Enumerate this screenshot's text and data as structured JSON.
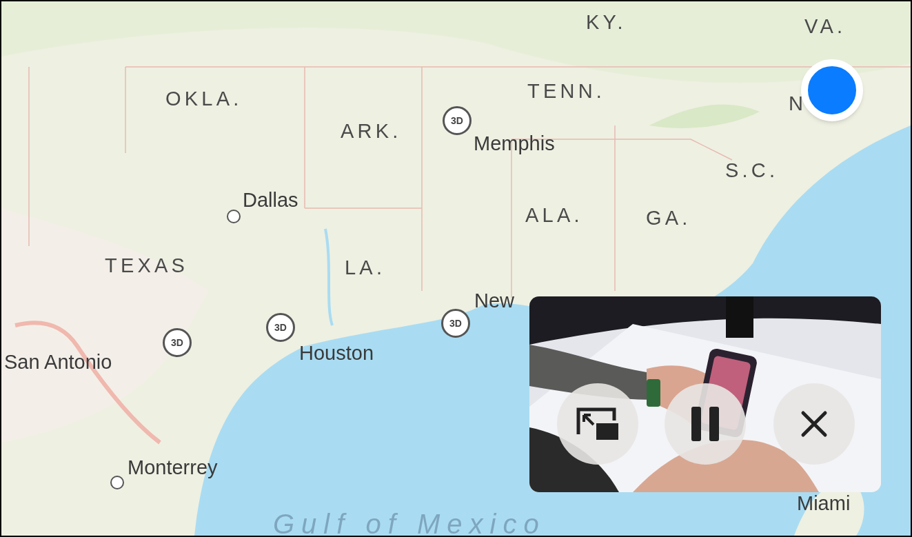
{
  "map": {
    "kind": "picture",
    "labels": [
      {
        "text": "KY.",
        "kind": "region"
      },
      {
        "text": "VA.",
        "kind": "region"
      },
      {
        "text": "OKLA.",
        "kind": "region"
      },
      {
        "text": "TENN.",
        "kind": "region"
      },
      {
        "text": "N",
        "kind": "region"
      },
      {
        "text": "ARK.",
        "kind": "region"
      },
      {
        "text": "Memphis",
        "kind": "city"
      },
      {
        "text": "S.C.",
        "kind": "region"
      },
      {
        "text": "Dallas",
        "kind": "city"
      },
      {
        "text": "ALA.",
        "kind": "region"
      },
      {
        "text": "GA.",
        "kind": "region"
      },
      {
        "text": "TEXAS",
        "kind": "region"
      },
      {
        "text": "LA.",
        "kind": "region"
      },
      {
        "text": "New",
        "kind": "city"
      },
      {
        "text": "Houston",
        "kind": "city"
      },
      {
        "text": "San Antonio",
        "kind": "city"
      },
      {
        "text": "Monterrey",
        "kind": "city"
      },
      {
        "text": "Miami",
        "kind": "city"
      },
      {
        "text": "Gulf of Mexico",
        "kind": "water"
      }
    ],
    "markers": [
      {
        "kind": "flyover",
        "text": "3D"
      },
      {
        "kind": "flyover",
        "text": "3D"
      },
      {
        "kind": "flyover",
        "text": "3D"
      },
      {
        "kind": "flyover",
        "text": "3D"
      },
      {
        "kind": "city-dot"
      },
      {
        "kind": "city-dot"
      },
      {
        "kind": "location"
      }
    ]
  },
  "pip": {
    "buttons": [
      {
        "kind": "restore"
      },
      {
        "kind": "pause"
      },
      {
        "kind": "close"
      }
    ]
  }
}
